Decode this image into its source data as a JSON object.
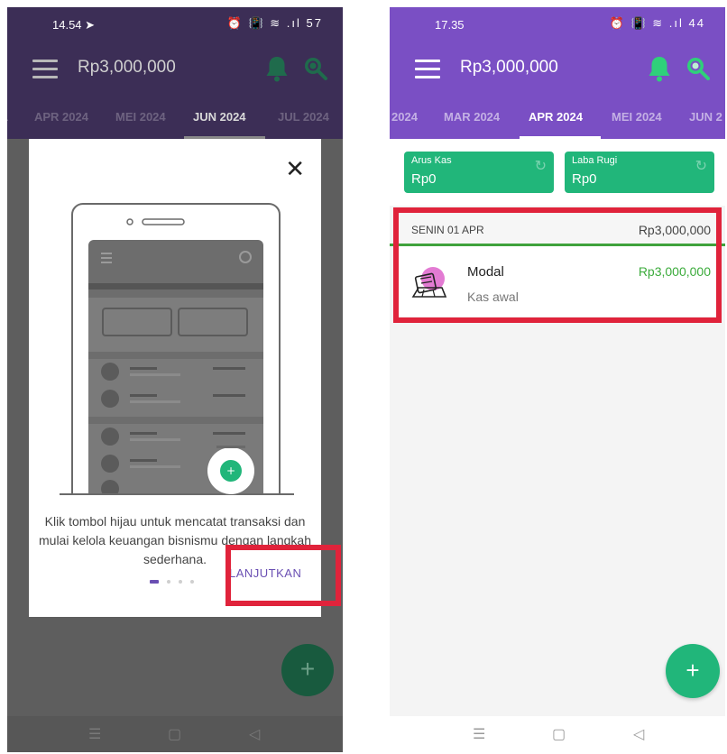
{
  "left": {
    "status": {
      "time": "14.54 ➤",
      "icons": "⏰ 📳 ≋ .ıl 57"
    },
    "appbar": {
      "balance": "Rp3,000,000"
    },
    "tabs": [
      "APR 2024",
      "MEI 2024",
      "JUN 2024",
      "JUL 2024"
    ],
    "active_tab": "JUN 2024",
    "modal": {
      "close_glyph": "✕",
      "message": "Klik tombol hijau untuk mencatat transaksi dan mulai kelola keuangan bisnismu dengan langkah sederhana.",
      "next_label": "LANJUTKAN",
      "page_count": 4,
      "page_active": 1
    },
    "fab": "+",
    "nav": [
      "☰",
      "▢",
      "◁"
    ]
  },
  "right": {
    "status": {
      "time": "17.35",
      "icons": "⏰ 📳 ≋ .ıl 44"
    },
    "appbar": {
      "balance": "Rp3,000,000"
    },
    "tabs": [
      "2024",
      "MAR 2024",
      "APR 2024",
      "MEI 2024",
      "JUN 2"
    ],
    "active_tab": "APR 2024",
    "summary": {
      "cash_flow": {
        "label": "Arus Kas",
        "value": "Rp0"
      },
      "profit_loss": {
        "label": "Laba Rugi",
        "value": "Rp0"
      }
    },
    "day": {
      "date": "SENIN 01 APR",
      "total": "Rp3,000,000"
    },
    "transaction": {
      "title": "Modal",
      "subtitle": "Kas awal",
      "amount": "Rp3,000,000"
    },
    "fab": "+",
    "nav": [
      "☰",
      "▢",
      "◁"
    ]
  },
  "colors": {
    "purple": "#7a4fc4",
    "green": "#21b67a",
    "highlight_red": "#e0233b",
    "amount_green": "#3bab3b"
  },
  "icons": [
    "menu-icon",
    "bell-icon",
    "search-icon",
    "close-icon",
    "refresh-icon",
    "ledger-icon",
    "plus-icon"
  ]
}
